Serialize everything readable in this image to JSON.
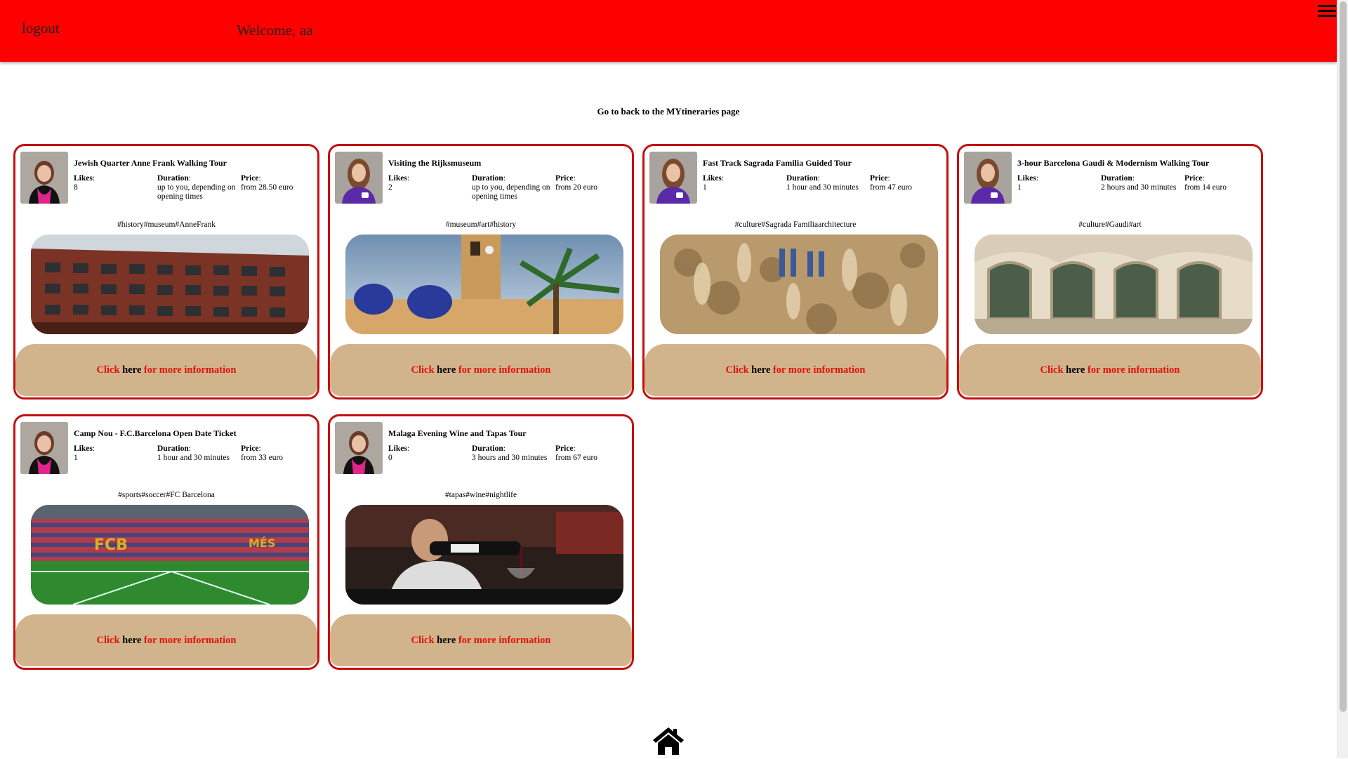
{
  "header": {
    "logout_label": "logout",
    "welcome_label": "Welcome,",
    "username": "aa",
    "menu_icon": "hamburger-menu-icon",
    "background": "#ff0000"
  },
  "back_link": "Go to back to the MYtineraries page",
  "labels": {
    "likes": "Likes",
    "duration": "Duration",
    "price": "Price",
    "click": "Click",
    "here": "here",
    "more": "for more information"
  },
  "itineraries": [
    {
      "title": "Jewish Quarter Anne Frank Walking Tour",
      "likes": "8",
      "duration": "up to you, depending on opening times",
      "price": "from 28.50 euro",
      "tags": "#history#museum#AnneFrank",
      "image": "brick-building-photo"
    },
    {
      "title": "Visiting the Rijksmuseum",
      "likes": "2",
      "duration": "up to you, depending on opening times",
      "price": "from 20 euro",
      "tags": "#museum#art#history",
      "image": "church-tower-palm-photo"
    },
    {
      "title": "Fast Track Sagrada Familia Guided Tour",
      "likes": "1",
      "duration": "1 hour and 30 minutes",
      "price": "from 47 euro",
      "tags": "#culture#Sagrada Familiaarchitecture",
      "image": "sagrada-facade-photo"
    },
    {
      "title": "3-hour Barcelona Gaudi & Modernism Walking Tour",
      "likes": "1",
      "duration": "2 hours and 30 minutes",
      "price": "from 14 euro",
      "tags": "#culture#Gaudi#art",
      "image": "casa-batllo-photo"
    },
    {
      "title": "Camp Nou - F.C.Barcelona Open Date Ticket",
      "likes": "1",
      "duration": "1 hour and 30 minutes",
      "price": "from 33 euro",
      "tags": "#sports#soccer#FC Barcelona",
      "image": "stadium-photo"
    },
    {
      "title": "Malaga Evening Wine and Tapas Tour",
      "likes": "0",
      "duration": "3 hours and 30 minutes",
      "price": "from 67 euro",
      "tags": "#tapas#wine#nightlife",
      "image": "wine-pour-photo"
    }
  ],
  "footer": {
    "icon": "home-icon"
  },
  "colors": {
    "accent": "#ff0000",
    "card_border": "#c41010",
    "card_footer": "#d2b48c",
    "link_red": "#e3120b"
  }
}
